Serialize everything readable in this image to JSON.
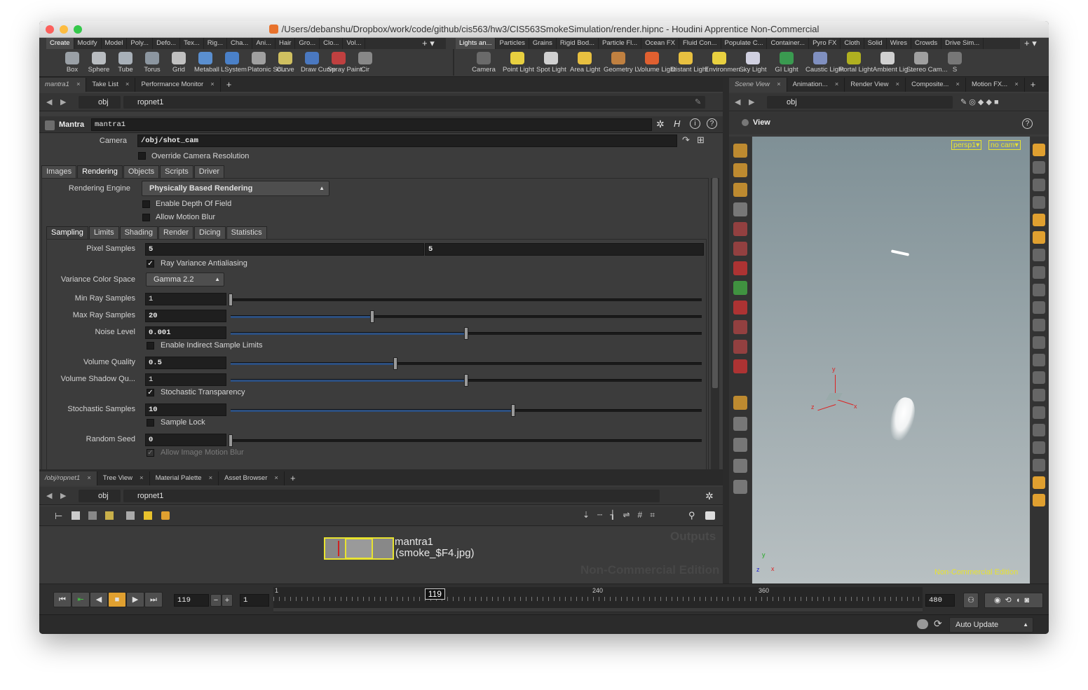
{
  "window": {
    "title": "/Users/debanshu/Dropbox/work/code/github/cis563/hw3/CIS563SmokeSimulation/render.hipnc - Houdini Apprentice Non-Commercial"
  },
  "shelf_left": {
    "tabs": [
      "Create",
      "Modify",
      "Model",
      "Poly...",
      "Defo...",
      "Tex...",
      "Rig...",
      "Cha...",
      "Ani...",
      "Hair",
      "Gro...",
      "Clo...",
      "Vol..."
    ],
    "tools": [
      {
        "label": "Box",
        "icon": "box-icon"
      },
      {
        "label": "Sphere",
        "icon": "sphere-icon"
      },
      {
        "label": "Tube",
        "icon": "tube-icon"
      },
      {
        "label": "Torus",
        "icon": "torus-icon"
      },
      {
        "label": "Grid",
        "icon": "grid-icon"
      },
      {
        "label": "Metaball",
        "icon": "metaball-icon"
      },
      {
        "label": "LSystem",
        "icon": "lsystem-icon"
      },
      {
        "label": "Platonic Sol...",
        "icon": "platonic-icon"
      },
      {
        "label": "Curve",
        "icon": "curve-icon"
      },
      {
        "label": "Draw Curve",
        "icon": "draw-curve-icon"
      },
      {
        "label": "Spray Paint",
        "icon": "spray-paint-icon"
      },
      {
        "label": "Cir",
        "icon": "circle-icon"
      }
    ]
  },
  "shelf_right": {
    "tabs": [
      "Lights an...",
      "Particles",
      "Grains",
      "Rigid Bod...",
      "Particle Fl...",
      "Ocean FX",
      "Fluid Con...",
      "Populate C...",
      "Container...",
      "Pyro FX",
      "Cloth",
      "Solid",
      "Wires",
      "Crowds",
      "Drive Sim..."
    ],
    "tools": [
      {
        "label": "Camera",
        "icon": "camera-icon"
      },
      {
        "label": "Point Light",
        "icon": "point-light-icon"
      },
      {
        "label": "Spot Light",
        "icon": "spot-light-icon"
      },
      {
        "label": "Area Light",
        "icon": "area-light-icon"
      },
      {
        "label": "Geometry L...",
        "icon": "geometry-light-icon"
      },
      {
        "label": "Volume Light",
        "icon": "volume-light-icon"
      },
      {
        "label": "Distant Light",
        "icon": "distant-light-icon"
      },
      {
        "label": "Environmen...",
        "icon": "environment-light-icon"
      },
      {
        "label": "Sky Light",
        "icon": "sky-light-icon"
      },
      {
        "label": "GI Light",
        "icon": "gi-light-icon"
      },
      {
        "label": "Caustic Light",
        "icon": "caustic-light-icon"
      },
      {
        "label": "Portal Light",
        "icon": "portal-light-icon"
      },
      {
        "label": "Ambient Lig...",
        "icon": "ambient-light-icon"
      },
      {
        "label": "Stereo Cam...",
        "icon": "stereo-camera-icon"
      },
      {
        "label": "S",
        "icon": "more-icon"
      }
    ]
  },
  "param_pane": {
    "tabs": [
      "mantra1",
      "Take List",
      "Performance Monitor"
    ],
    "path": {
      "root": "obj",
      "node": "ropnet1"
    },
    "node_type": "Mantra",
    "node_name": "mantra1",
    "camera_label": "Camera",
    "camera_value": "/obj/shot_cam",
    "override_label": "Override Camera Resolution",
    "main_tabs": [
      "Images",
      "Rendering",
      "Objects",
      "Scripts",
      "Driver"
    ],
    "engine_label": "Rendering Engine",
    "engine_value": "Physically Based Rendering",
    "dof_label": "Enable Depth Of Field",
    "motion_blur_label": "Allow Motion Blur",
    "sub_tabs": [
      "Sampling",
      "Limits",
      "Shading",
      "Render",
      "Dicing",
      "Statistics"
    ],
    "pixel_samples_label": "Pixel Samples",
    "pixel_samples": [
      "5",
      "5"
    ],
    "ray_variance_label": "Ray Variance Antialiasing",
    "variance_cs_label": "Variance Color Space",
    "variance_cs_value": "Gamma 2.2",
    "sliders": [
      {
        "label": "Min Ray Samples",
        "value": "1",
        "level": 0.0
      },
      {
        "label": "Max Ray Samples",
        "value": "20",
        "level": 0.3
      },
      {
        "label": "Noise Level",
        "value": "0.001",
        "level": 0.5
      },
      {
        "label": "Volume Quality",
        "value": "0.5",
        "level": 0.35
      },
      {
        "label": "Volume Shadow Qu...",
        "value": "1",
        "level": 0.5
      },
      {
        "label": "Stochastic Samples",
        "value": "10",
        "level": 0.6
      },
      {
        "label": "Random Seed",
        "value": "0",
        "level": 0.0
      }
    ],
    "indirect_label": "Enable Indirect Sample Limits",
    "stochastic_label": "Stochastic Transparency",
    "sample_lock_label": "Sample Lock",
    "image_mb_label": "Allow Image Motion Blur"
  },
  "network_pane": {
    "tabs": [
      "/obj/ropnet1",
      "Tree View",
      "Material Palette",
      "Asset Browser"
    ],
    "path": {
      "root": "obj",
      "node": "ropnet1"
    },
    "node_name": "mantra1",
    "node_output": "(smoke_$F4.jpg)",
    "watermark_outputs": "Outputs",
    "watermark_edition": "Non-Commercial Edition"
  },
  "scene_pane": {
    "tabs": [
      "Scene View",
      "Animation...",
      "Render View",
      "Composite...",
      "Motion FX..."
    ],
    "path": {
      "root": "obj"
    },
    "view_label": "View",
    "camera_menu": "persp1",
    "cam_menu": "no cam",
    "watermark": "Non-Commercial Edition"
  },
  "timeline": {
    "current_frame": "119",
    "start_frame": "1",
    "end_frame": "480",
    "ticks": [
      "1",
      "240",
      "360"
    ],
    "marker": "119",
    "progress": 0.246
  },
  "status": {
    "update_mode": "Auto Update"
  }
}
